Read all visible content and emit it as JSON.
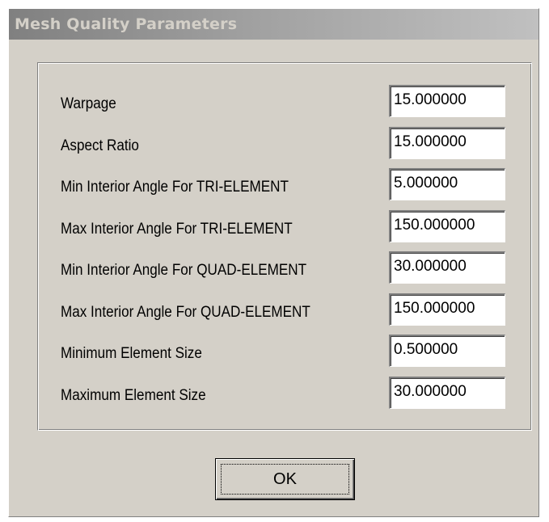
{
  "window": {
    "title": "Mesh Quality Parameters"
  },
  "parameters": [
    {
      "label": "Warpage",
      "value": "15.000000"
    },
    {
      "label": "Aspect Ratio",
      "value": "15.000000"
    },
    {
      "label": "Min Interior Angle For TRI-ELEMENT",
      "value": "5.000000"
    },
    {
      "label": "Max Interior Angle For TRI-ELEMENT",
      "value": "150.000000"
    },
    {
      "label": "Min Interior Angle For QUAD-ELEMENT",
      "value": "30.000000"
    },
    {
      "label": "Max Interior Angle For QUAD-ELEMENT",
      "value": "150.000000"
    },
    {
      "label": "Minimum Element Size",
      "value": "0.500000"
    },
    {
      "label": "Maximum Element Size",
      "value": "30.000000"
    }
  ],
  "buttons": {
    "ok_label": "OK"
  }
}
